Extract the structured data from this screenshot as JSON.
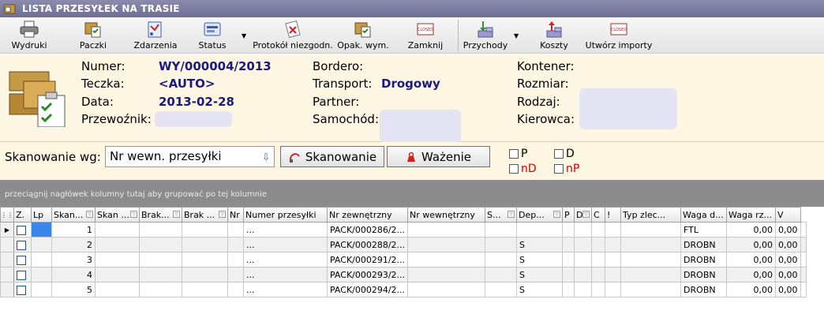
{
  "window": {
    "title": "LISTA PRZESYŁEK NA TRASIE"
  },
  "toolbar": {
    "wydruki": "Wydruki",
    "paczki": "Paczki",
    "zdarzenia": "Zdarzenia",
    "status": "Status",
    "protokol": "Protokół niezgodn.",
    "opak": "Opak. wym.",
    "zamknij": "Zamknij",
    "przychody": "Przychody",
    "koszty": "Koszty",
    "importy": "Utwórz importy"
  },
  "header": {
    "numer_label": "Numer:",
    "numer": "WY/000004/2013",
    "teczka_label": "Teczka:",
    "teczka": "<AUTO>",
    "data_label": "Data:",
    "data": "2013-02-28",
    "przewoznik_label": "Przewoźnik:",
    "bordero_label": "Bordero:",
    "transport_label": "Transport:",
    "transport": "Drogowy",
    "partner_label": "Partner:",
    "samochod_label": "Samochód:",
    "kontener_label": "Kontener:",
    "rozmiar_label": "Rozmiar:",
    "rodzaj_label": "Rodzaj:",
    "kierowca_label": "Kierowca:"
  },
  "scan": {
    "label": "Skanowanie wg:",
    "select_value": "Nr wewn. przesyłki",
    "scan_button": "Skanowanie",
    "weigh_button": "Ważenie",
    "check_p": "P",
    "check_d": "D",
    "check_np": "nP",
    "check_nd": "nD"
  },
  "group_panel": {
    "text": "przeciągnij nagłówek kolumny tutaj aby grupować po tej kolumnie"
  },
  "grid": {
    "headers": [
      "Z.",
      "Lp",
      "Skan...",
      "Skan ...",
      "Brak...",
      "Brak ...",
      "Nr",
      "Numer przesyłki",
      "Nr zewnętrzny",
      "Nr wewnętrzny",
      "S...",
      "Dep...",
      "P",
      "D",
      "C",
      "!",
      "Typ zlec...",
      "Waga d...",
      "Waga rz...",
      "V"
    ],
    "rows": [
      {
        "lp": "1",
        "nr": "...",
        "numer": "PACK/000286/2...",
        "s": "",
        "typ": "FTL",
        "waga_d": "0,00",
        "waga_rz": "0,00"
      },
      {
        "lp": "2",
        "nr": "...",
        "numer": "PACK/000288/2...",
        "s": "S",
        "typ": "DROBN",
        "waga_d": "0,00",
        "waga_rz": "0,00"
      },
      {
        "lp": "3",
        "nr": "...",
        "numer": "PACK/000291/2...",
        "s": "S",
        "typ": "DROBN",
        "waga_d": "0,00",
        "waga_rz": "0,00"
      },
      {
        "lp": "4",
        "nr": "...",
        "numer": "PACK/000293/2...",
        "s": "S",
        "typ": "DROBN",
        "waga_d": "0,00",
        "waga_rz": "0,00"
      },
      {
        "lp": "5",
        "nr": "...",
        "numer": "PACK/000294/2...",
        "s": "S",
        "typ": "DROBN",
        "waga_d": "0,00",
        "waga_rz": "0,00"
      }
    ]
  },
  "colors": {
    "accent": "#1a1a7a",
    "title_bar": "#7c7ca2",
    "panel": "#fdf6e3",
    "red": "#cc0000"
  }
}
